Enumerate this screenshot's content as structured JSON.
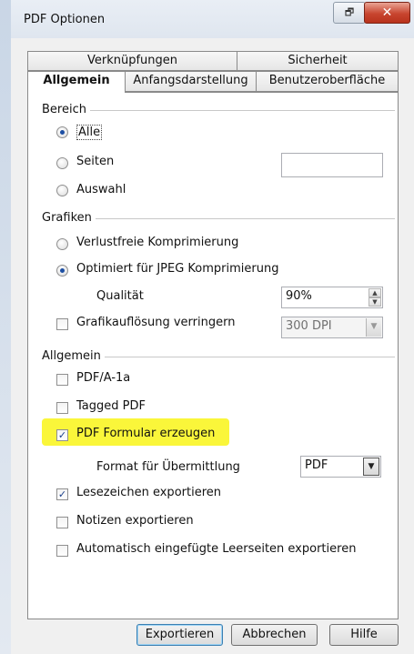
{
  "window": {
    "title": "PDF Optionen",
    "restore_glyph": "🗗",
    "close_glyph": "✕"
  },
  "tabs": {
    "row_top": [
      {
        "label": "Verknüpfungen"
      },
      {
        "label": "Sicherheit"
      }
    ],
    "row_bottom": [
      {
        "label": "Allgemein",
        "active": true
      },
      {
        "label": "Anfangsdarstellung"
      },
      {
        "label": "Benutzeroberfläche"
      }
    ]
  },
  "bereich": {
    "title": "Bereich",
    "all": "Alle",
    "pages": "Seiten",
    "pages_value": "",
    "selection": "Auswahl",
    "selected": "all"
  },
  "grafiken": {
    "title": "Grafiken",
    "lossless": "Verlustfreie Komprimierung",
    "jpeg": "Optimiert für JPEG Komprimierung",
    "selected": "jpeg",
    "quality_label": "Qualität",
    "quality_value": "90%",
    "reduce_label": "Grafikauflösung verringern",
    "reduce_checked": false,
    "dpi_value": "300 DPI"
  },
  "allgemein": {
    "title": "Allgemein",
    "pdfa": {
      "label": "PDF/A-1a",
      "checked": false
    },
    "tagged": {
      "label": "Tagged PDF",
      "checked": false
    },
    "form": {
      "label": "PDF Formular erzeugen",
      "checked": true
    },
    "format_label": "Format für Übermittlung",
    "format_value": "PDF",
    "bookmarks": {
      "label": "Lesezeichen exportieren",
      "checked": true
    },
    "notes": {
      "label": "Notizen exportieren",
      "checked": false
    },
    "blank_pages": {
      "label": "Automatisch eingefügte Leerseiten exportieren",
      "checked": false
    }
  },
  "buttons": {
    "export": "Exportieren",
    "cancel": "Abbrechen",
    "help": "Hilfe"
  },
  "colors": {
    "highlight": "#faf63a",
    "close_button": "#c8452f"
  }
}
